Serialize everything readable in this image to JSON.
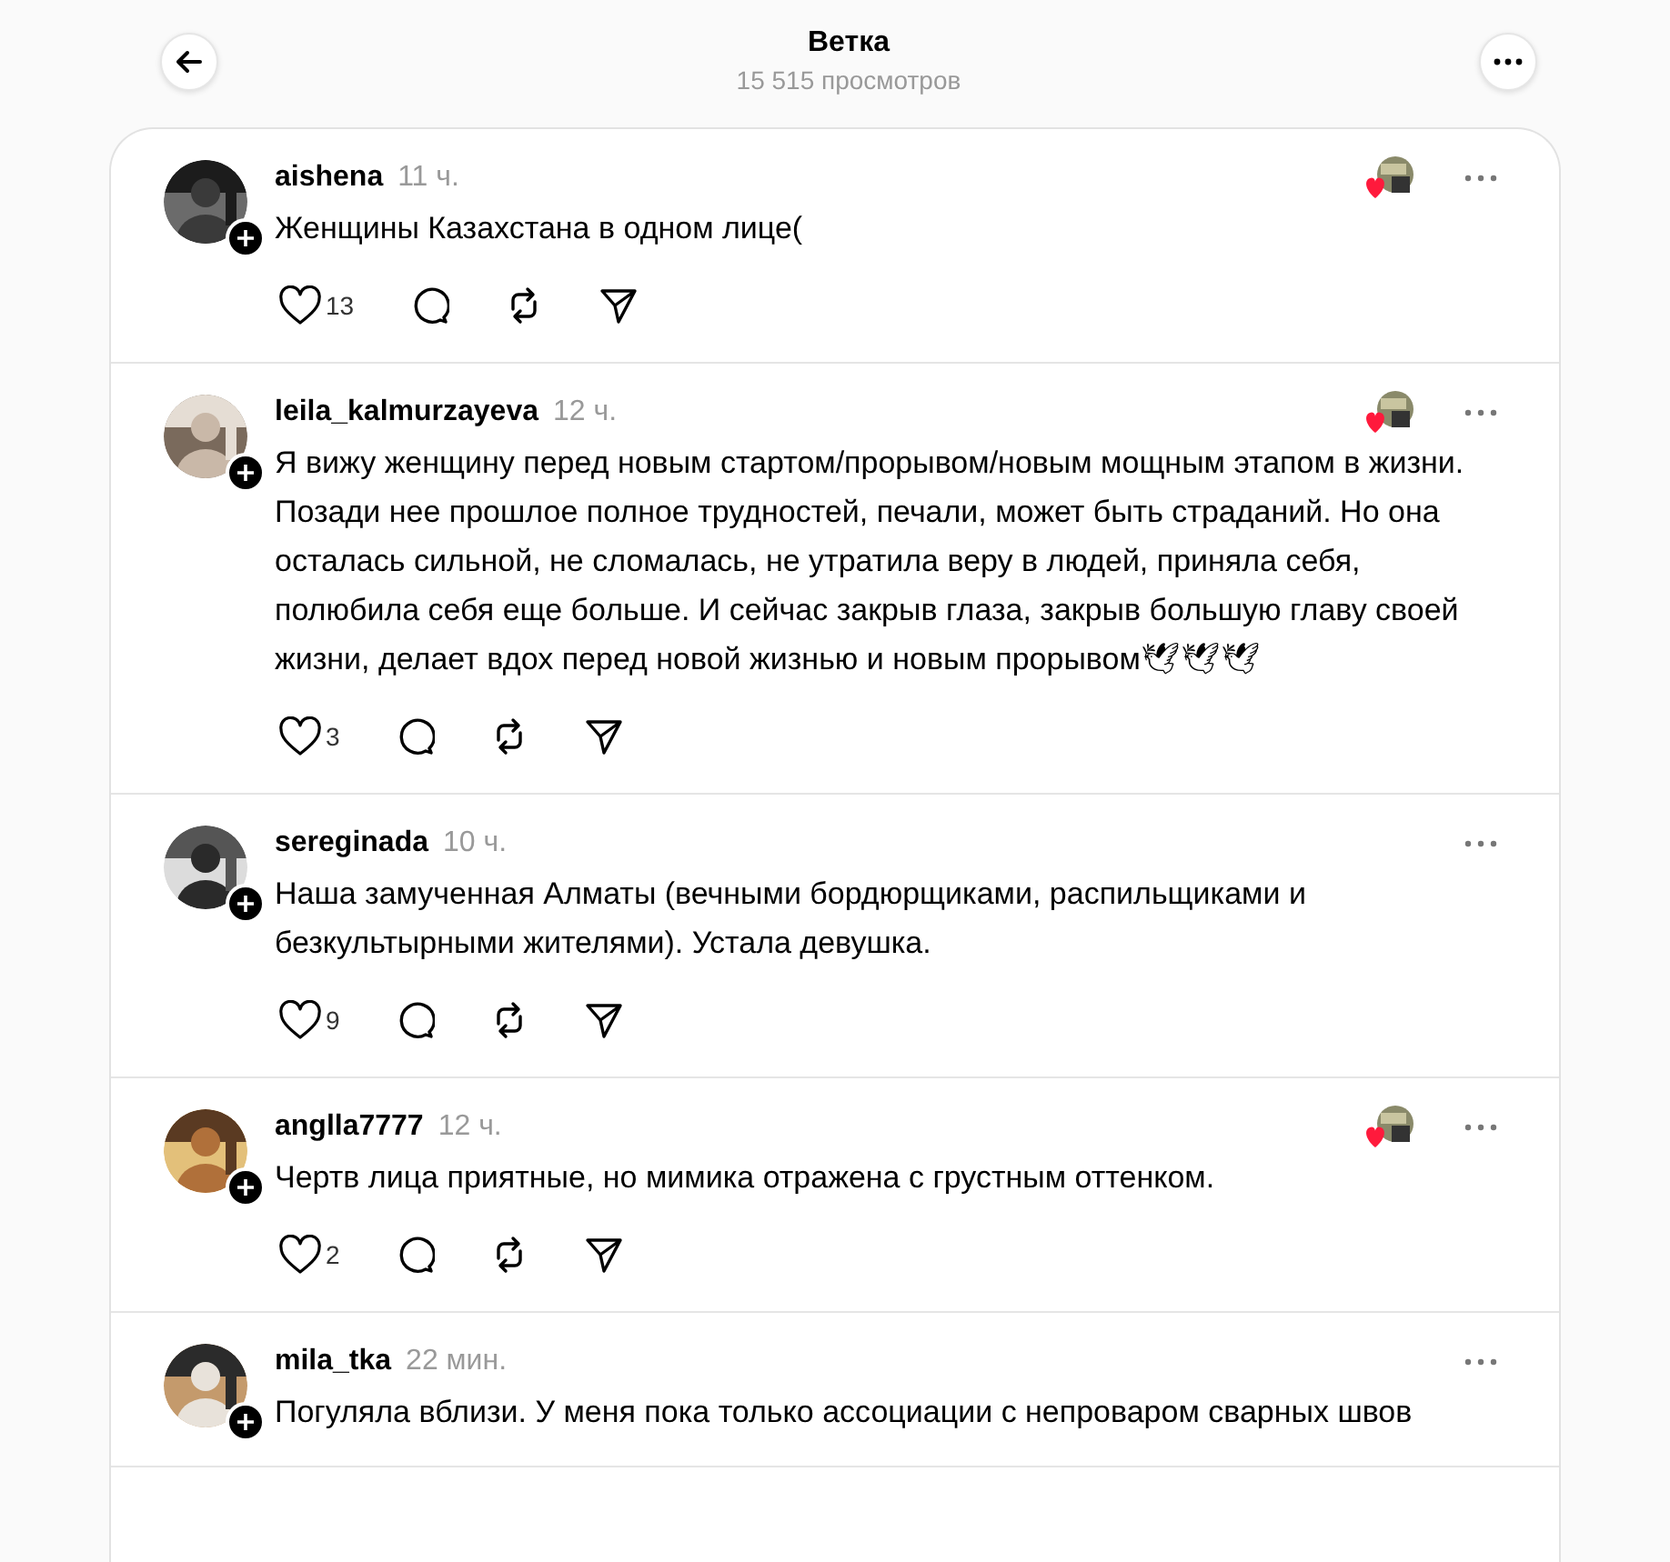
{
  "header": {
    "title": "Ветка",
    "subtitle": "15 515 просмотров"
  },
  "posts": [
    {
      "username": "aishena",
      "time": "11 ч.",
      "text": "Женщины Казахстана в одном лице(",
      "author_liked": true,
      "likes": "13"
    },
    {
      "username": "leila_kalmurzayeva",
      "time": "12 ч.",
      "text": "Я вижу женщину перед новым стартом/прорывом/новым мощным этапом в жизни. Позади нее прошлое полное трудностей, печали, может быть страданий. Но она осталась сильной, не сломалась, не утратила веру в людей, приняла себя, полюбила себя еще больше. И сейчас закрыв глаза, закрыв большую главу своей жизни, делает вдох перед новой жизнью и новым прорывом🕊🕊🕊",
      "author_liked": true,
      "likes": "3"
    },
    {
      "username": "sereginada",
      "time": "10 ч.",
      "text": "Наша замученная Алматы (вечными бордюрщиками, распильщиками и безкультырными жителями). Устала девушка.",
      "author_liked": false,
      "likes": "9"
    },
    {
      "username": "anglla7777",
      "time": "12 ч.",
      "text": "Чертв лица приятные, но мимика отражена с грустным оттенком.",
      "author_liked": true,
      "likes": "2"
    },
    {
      "username": "mila_tka",
      "time": "22 мин.",
      "text": "Погуляла вблизи. У меня пока только ассоциации с непроваром сварных швов",
      "author_liked": false
    }
  ]
}
